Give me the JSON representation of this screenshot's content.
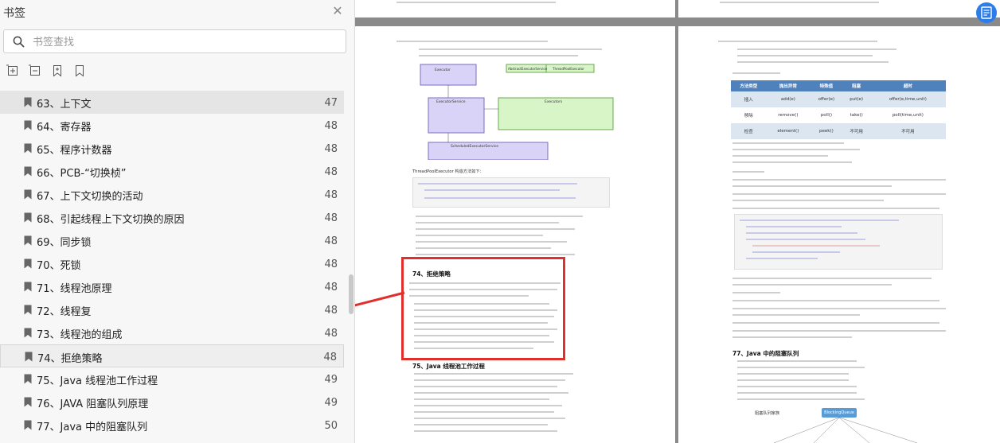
{
  "sidebar": {
    "title": "书签",
    "search_placeholder": "书签查找",
    "items": [
      {
        "label": "63、上下文",
        "page": "47"
      },
      {
        "label": "64、寄存器",
        "page": "48"
      },
      {
        "label": "65、程序计数器",
        "page": "48"
      },
      {
        "label": "66、PCB-“切换桢”",
        "page": "48"
      },
      {
        "label": "67、上下文切换的活动",
        "page": "48"
      },
      {
        "label": "68、引起线程上下文切换的原因",
        "page": "48"
      },
      {
        "label": "69、同步锁",
        "page": "48"
      },
      {
        "label": "70、死锁",
        "page": "48"
      },
      {
        "label": "71、线程池原理",
        "page": "48"
      },
      {
        "label": "72、线程复",
        "page": "48"
      },
      {
        "label": "73、线程池的组成",
        "page": "48"
      },
      {
        "label": "74、拒绝策略",
        "page": "48"
      },
      {
        "label": "75、Java 线程池工作过程",
        "page": "49"
      },
      {
        "label": "76、JAVA 阻塞队列原理",
        "page": "49"
      },
      {
        "label": "77、Java 中的阻塞队列",
        "page": "50"
      }
    ]
  },
  "doc": {
    "left_page": {
      "section_74_title": "74、拒绝策略",
      "section_75_title": "75、Java 线程池工作过程",
      "diagram_boxes": {
        "executor": "Executor",
        "abstract": "AbstractExecutorService",
        "tpe": "ThreadPoolExecutor",
        "service": "ExecutorService",
        "executors": "Executors",
        "scheduled": "ScheduledExecutorService"
      },
      "code_caption": "ThreadPoolExecutor 构造方法如下："
    },
    "right_page": {
      "section_77_title": "77、Java 中的阻塞队列",
      "table_headers": [
        "方法类型",
        "抛出异常",
        "特殊值",
        "阻塞",
        "超时"
      ],
      "table_rows": [
        [
          "插入",
          "add(e)",
          "offer(e)",
          "put(e)",
          "offer(e,time,unit)"
        ],
        [
          "移除",
          "remove()",
          "poll()",
          "take()",
          "poll(time,unit)"
        ],
        [
          "检查",
          "element()",
          "peek()",
          "不可用",
          "不可用"
        ]
      ],
      "diagram_node": "BlockingQueue",
      "diagram_label_left": "阻塞队列家族"
    }
  },
  "colors": {
    "highlight": "#e0302c",
    "accent": "#2b7de9",
    "table_header": "#4f81bd"
  }
}
